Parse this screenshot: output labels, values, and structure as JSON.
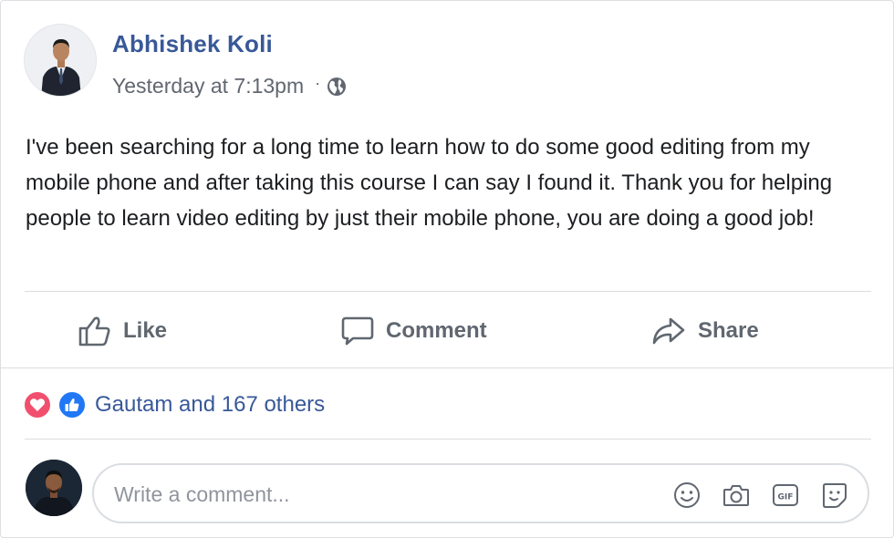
{
  "post": {
    "author": "Abhishek Koli",
    "timestamp": "Yesterday at 7:13pm",
    "separator": "·",
    "privacy_icon": "globe-icon",
    "text": "I've been searching for a long time to learn how to do some good editing from my mobile phone and after taking this course I can say I found it. Thank you for helping people to learn video editing by just their mobile phone, you are doing a good job!"
  },
  "actions": {
    "like_label": "Like",
    "comment_label": "Comment",
    "share_label": "Share"
  },
  "reactions": {
    "icons": [
      "heart-icon",
      "thumbs-up-icon"
    ],
    "summary": "Gautam and 167 others"
  },
  "composer": {
    "placeholder": "Write a comment...",
    "value": "",
    "icons": [
      "emoji-icon",
      "camera-icon",
      "gif-icon",
      "sticker-icon"
    ]
  },
  "colors": {
    "author_link": "#385898",
    "secondary_text": "#616770",
    "action_text": "#606770",
    "love": "#f0506e",
    "like": "#2078f4",
    "divider": "#dadde1"
  }
}
